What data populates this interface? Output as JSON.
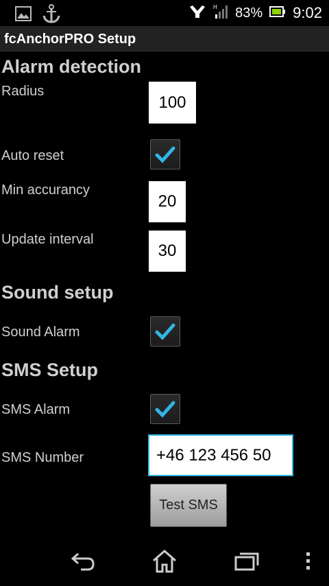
{
  "status_bar": {
    "battery_percent": "83%",
    "time": "9:02",
    "icons": [
      "gallery-icon",
      "anchor-icon",
      "wifi-icon",
      "signal-icon",
      "battery-icon"
    ]
  },
  "app": {
    "title": "fcAnchorPRO Setup"
  },
  "alarm_detection": {
    "heading": "Alarm detection",
    "radius_label": "Radius",
    "radius_value": "100",
    "auto_reset_label": "Auto reset",
    "auto_reset_checked": true,
    "min_accuracy_label": "Min accurancy",
    "min_accuracy_value": "20",
    "update_interval_label": "Update interval",
    "update_interval_value": "30"
  },
  "sound_setup": {
    "heading": "Sound setup",
    "sound_alarm_label": "Sound Alarm",
    "sound_alarm_checked": true
  },
  "sms_setup": {
    "heading": "SMS Setup",
    "sms_alarm_label": "SMS Alarm",
    "sms_alarm_checked": true,
    "sms_number_label": "SMS Number",
    "sms_number_value": "+46 123 456 50",
    "test_button_label": "Test SMS"
  },
  "nav_bar": {
    "icons": [
      "back-icon",
      "home-icon",
      "recent-apps-icon",
      "overflow-menu-icon"
    ]
  },
  "colors": {
    "accent": "#33b5e5",
    "background": "#000000",
    "titlebar": "#222222"
  }
}
